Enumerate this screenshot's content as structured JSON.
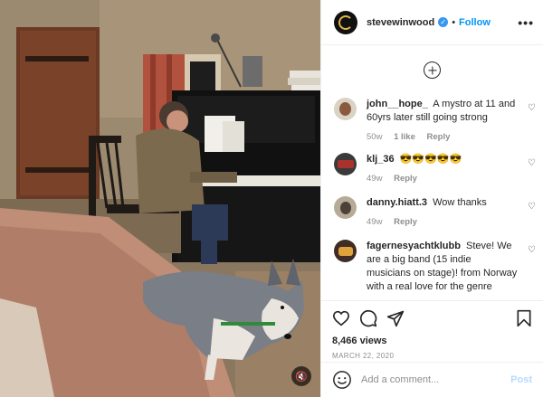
{
  "post": {
    "username": "stevewinwood",
    "verified": true,
    "separator": "•",
    "follow_label": "Follow",
    "more_icon": "more-options-icon"
  },
  "comments": [
    {
      "user": "john__hope_",
      "text": "A mystro at 11 and 60yrs later still going strong",
      "age": "50w",
      "likes": "1 like",
      "reply": "Reply"
    },
    {
      "user": "klj_36",
      "text": "😎😎😎😎😎",
      "age": "49w",
      "likes": "",
      "reply": "Reply"
    },
    {
      "user": "danny.hiatt.3",
      "text": "Wow thanks",
      "age": "49w",
      "likes": "",
      "reply": "Reply"
    },
    {
      "user": "fagernesyachtklubb",
      "text": "Steve! We are a big band (15 indie musicians on stage)! from Norway with a real love for the genre Yacht Rock. We",
      "age": "",
      "likes": "",
      "reply": ""
    }
  ],
  "actions": {
    "views": "8,466 views",
    "date": "MARCH 22, 2020"
  },
  "add_comment": {
    "placeholder": "Add a comment...",
    "post_label": "Post"
  },
  "colors": {
    "accent": "#0095f6",
    "post_disabled": "#b3dbff",
    "muted": "#8e8e8e"
  }
}
